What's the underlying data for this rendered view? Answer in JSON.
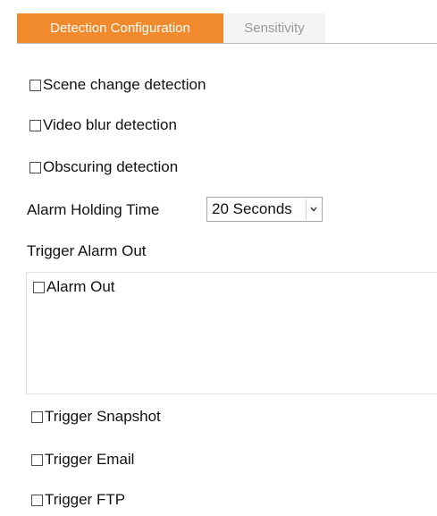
{
  "tabs": [
    {
      "label": "Detection Configuration",
      "active": true
    },
    {
      "label": "Sensitivity",
      "active": false
    }
  ],
  "detection": {
    "scene_change": {
      "label": "Scene change detection",
      "checked": false
    },
    "video_blur": {
      "label": "Video blur detection",
      "checked": false
    },
    "obscuring": {
      "label": "Obscuring detection",
      "checked": false
    }
  },
  "alarm_holding_time": {
    "label": "Alarm Holding Time",
    "selected": "20 Seconds"
  },
  "trigger_alarm_out": {
    "label": "Trigger Alarm Out",
    "alarm_out": {
      "label": "Alarm Out",
      "checked": false
    }
  },
  "triggers": {
    "snapshot": {
      "label": "Trigger Snapshot",
      "checked": false
    },
    "email": {
      "label": "Trigger Email",
      "checked": false
    },
    "ftp": {
      "label": "Trigger FTP",
      "checked": false
    }
  },
  "colors": {
    "accent": "#f08a2c",
    "tab_inactive_text": "#9a9a9a"
  }
}
